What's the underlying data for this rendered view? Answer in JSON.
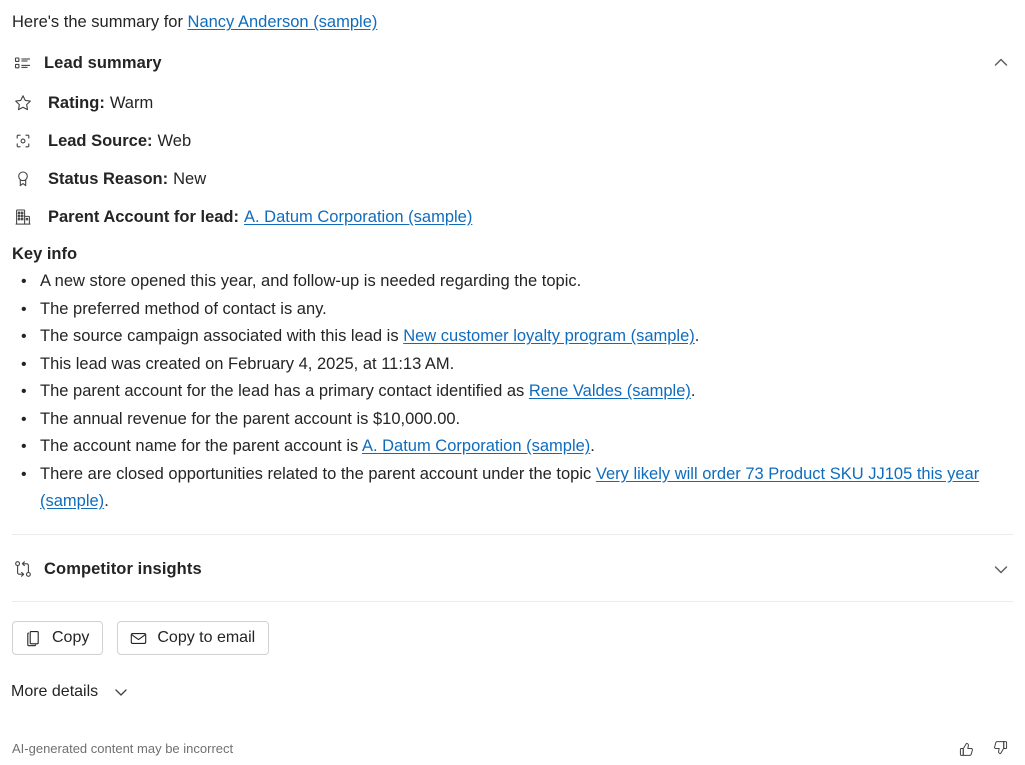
{
  "intro": {
    "prefix": "Here's the summary for ",
    "link": "Nancy Anderson (sample)"
  },
  "lead_summary": {
    "icon": "bulleted-list-icon",
    "title": "Lead summary",
    "expanded": true,
    "chevron": "chevron-up-icon",
    "details": [
      {
        "icon": "star-icon",
        "label": "Rating:",
        "value": "Warm",
        "link": null
      },
      {
        "icon": "target-icon",
        "label": "Lead Source:",
        "value": "Web",
        "link": null
      },
      {
        "icon": "ribbon-icon",
        "label": "Status Reason:",
        "value": "New",
        "link": null
      },
      {
        "icon": "building-icon",
        "label": "Parent Account for lead:",
        "value": null,
        "link": "A. Datum Corporation (sample)"
      }
    ]
  },
  "key_info": {
    "title": "Key info",
    "bullets": [
      {
        "parts": [
          {
            "t": "A new store opened this year, and follow-up is needed regarding the topic.",
            "link": false
          }
        ]
      },
      {
        "parts": [
          {
            "t": "The preferred method of contact is any.",
            "link": false
          }
        ]
      },
      {
        "parts": [
          {
            "t": "The source campaign associated with this lead is ",
            "link": false
          },
          {
            "t": "New customer loyalty program (sample)",
            "link": true
          },
          {
            "t": ".",
            "link": false
          }
        ]
      },
      {
        "parts": [
          {
            "t": "This lead was created on February 4, 2025, at 11:13 AM.",
            "link": false
          }
        ]
      },
      {
        "parts": [
          {
            "t": "The parent account for the lead has a primary contact identified as ",
            "link": false
          },
          {
            "t": "Rene Valdes (sample)",
            "link": true
          },
          {
            "t": ".",
            "link": false
          }
        ]
      },
      {
        "parts": [
          {
            "t": "The annual revenue for the parent account is $10,000.00.",
            "link": false
          }
        ]
      },
      {
        "parts": [
          {
            "t": "The account name for the parent account is ",
            "link": false
          },
          {
            "t": "A. Datum Corporation (sample)",
            "link": true
          },
          {
            "t": ".",
            "link": false
          }
        ]
      },
      {
        "parts": [
          {
            "t": "There are closed opportunities related to the parent account under the topic ",
            "link": false
          },
          {
            "t": "Very likely will order 73 Product SKU JJ105 this year (sample)",
            "link": true
          },
          {
            "t": ".",
            "link": false
          }
        ]
      }
    ]
  },
  "competitor_insights": {
    "icon": "branch-flow-icon",
    "title": "Competitor insights",
    "expanded": false,
    "chevron": "chevron-down-icon"
  },
  "actions": {
    "copy": {
      "icon": "copy-icon",
      "label": "Copy"
    },
    "copy_to_email": {
      "icon": "mail-icon",
      "label": "Copy to email"
    }
  },
  "more_details": {
    "label": "More details",
    "chevron": "chevron-down-icon"
  },
  "footer": {
    "note": "AI-generated content may be incorrect",
    "thumbs_up": "thumbs-up-icon",
    "thumbs_down": "thumbs-down-icon"
  },
  "colors": {
    "link": "#0f6cbd",
    "text": "#242424",
    "muted": "#707070",
    "divider": "#ebebeb",
    "border": "#d1d1d1"
  }
}
